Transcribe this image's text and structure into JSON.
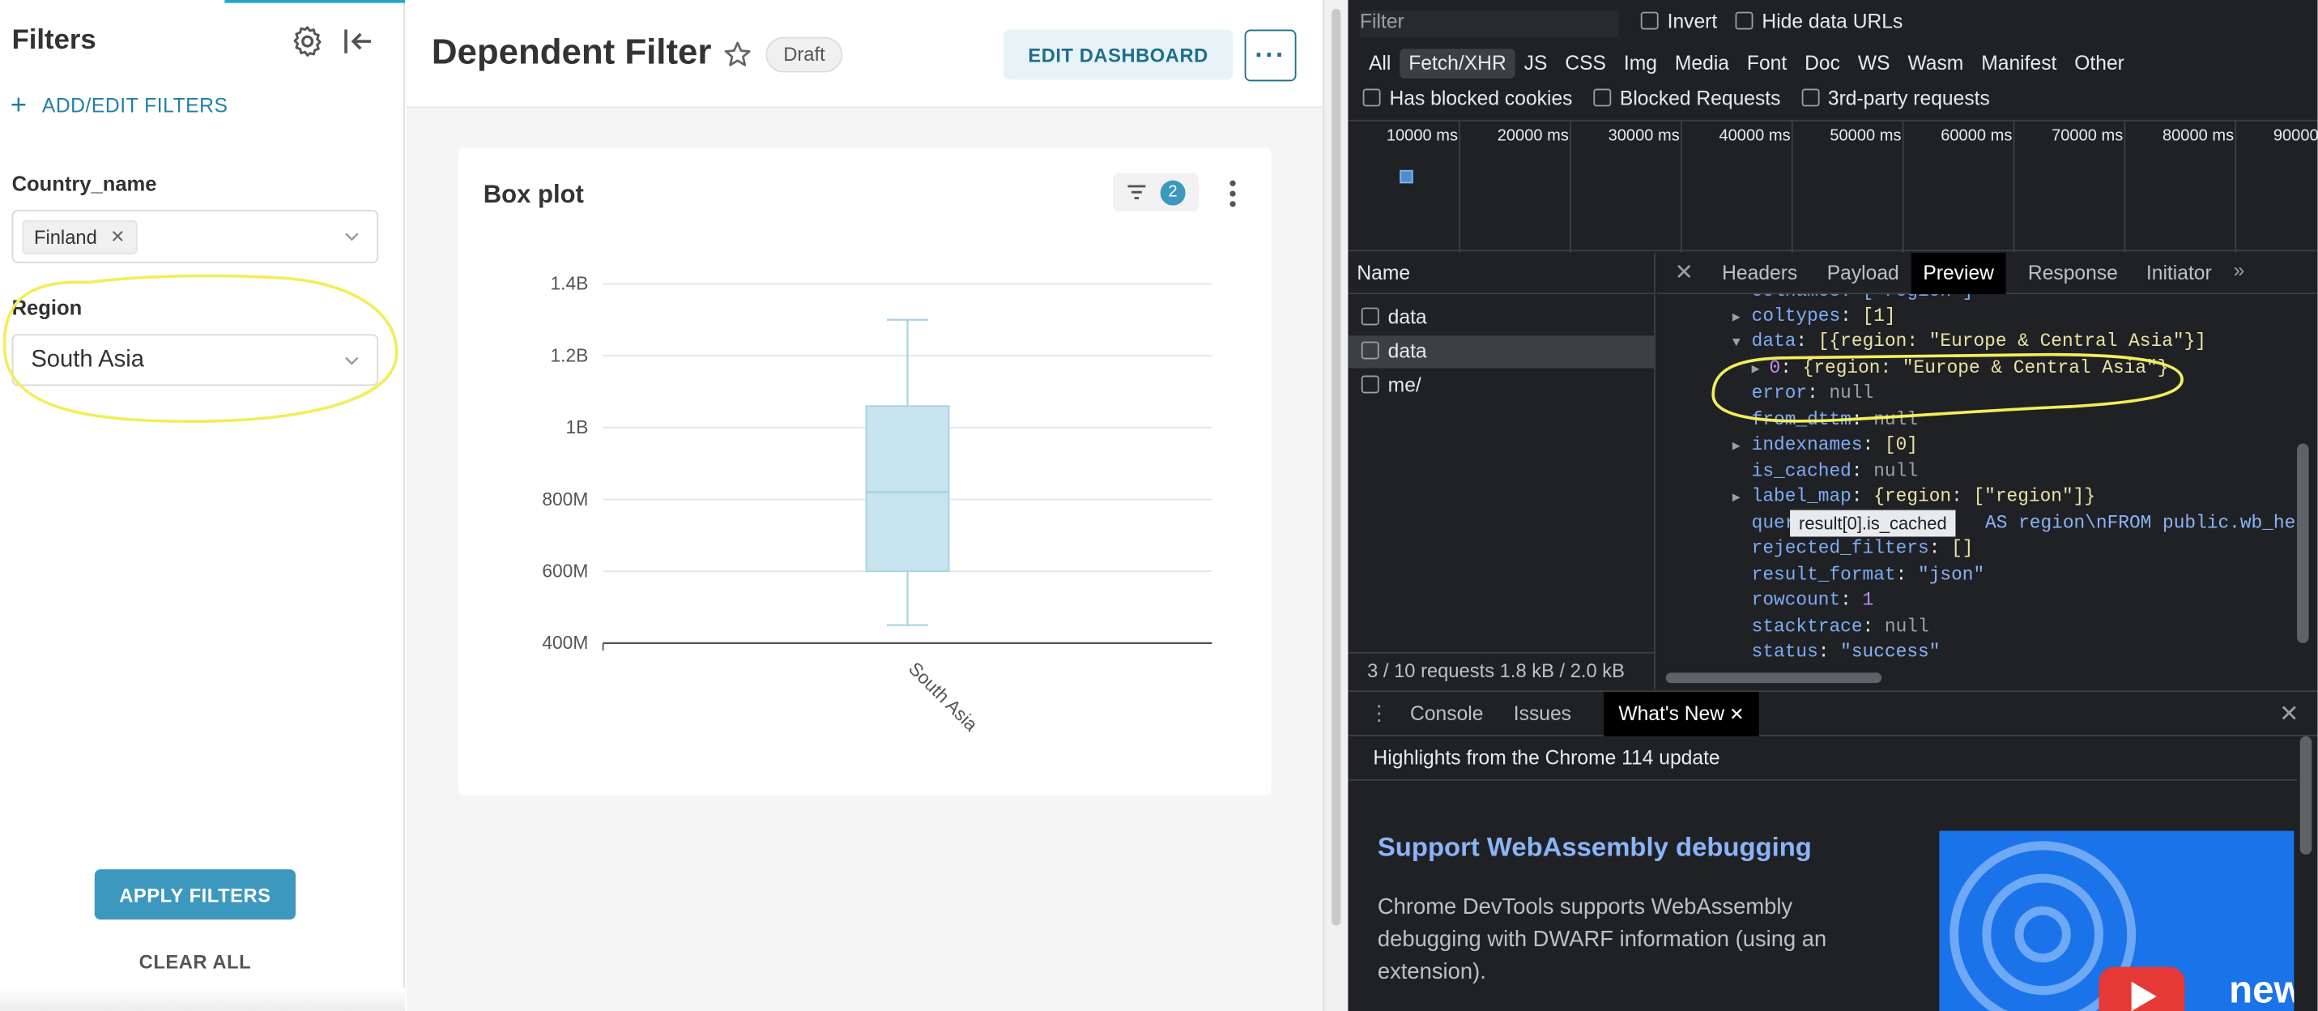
{
  "filters_panel": {
    "title": "Filters",
    "add_edit_label": "ADD/EDIT FILTERS",
    "country": {
      "label": "Country_name",
      "selected_tag": "Finland"
    },
    "region": {
      "label": "Region",
      "selected_value": "South Asia"
    },
    "apply_label": "APPLY FILTERS",
    "clear_label": "CLEAR ALL"
  },
  "dashboard": {
    "title": "Dependent Filter",
    "status_badge": "Draft",
    "edit_label": "EDIT DASHBOARD",
    "more_label": "···",
    "chart_card": {
      "title": "Box plot",
      "filter_count": "2"
    }
  },
  "chart_data": {
    "type": "box",
    "title": "Box plot",
    "categories": [
      "South Asia"
    ],
    "y_ticks": [
      "400M",
      "600M",
      "800M",
      "1B",
      "1.2B",
      "1.4B"
    ],
    "ylim": [
      400000000,
      1400000000
    ],
    "boxes": [
      {
        "category": "South Asia",
        "whisker_low": 450000000,
        "q1": 600000000,
        "median": 820000000,
        "q3": 1060000000,
        "whisker_high": 1300000000
      }
    ],
    "colors": {
      "box_fill": "#c6e3ee",
      "box_stroke": "#a9d3e3",
      "grid": "#dde8ee"
    }
  },
  "devtools": {
    "filter_placeholder": "Filter",
    "invert_label": "Invert",
    "hide_data_urls_label": "Hide data URLs",
    "type_filters": [
      "All",
      "Fetch/XHR",
      "JS",
      "CSS",
      "Img",
      "Media",
      "Font",
      "Doc",
      "WS",
      "Wasm",
      "Manifest",
      "Other"
    ],
    "active_type": "Fetch/XHR",
    "row3": [
      "Has blocked cookies",
      "Blocked Requests",
      "3rd-party requests"
    ],
    "timeline_labels": [
      "10000 ms",
      "20000 ms",
      "30000 ms",
      "40000 ms",
      "50000 ms",
      "60000 ms",
      "70000 ms",
      "80000 ms",
      "90000"
    ],
    "names_header": "Name",
    "requests": [
      "data",
      "data",
      "me/"
    ],
    "footer": "3 / 10 requests    1.8 kB / 2.0 kB",
    "detail_tabs": [
      "Headers",
      "Payload",
      "Preview",
      "Response",
      "Initiator"
    ],
    "active_detail_tab": "Preview",
    "json_lines": {
      "colnames_cut": "colnames: [\"region\"]",
      "coltypes_key": "coltypes",
      "coltypes_val": "[1]",
      "data_key": "data",
      "data_val": "[{region: \"Europe & Central Asia\"}]",
      "item0_key": "0",
      "item0_val": "{region: \"Europe & Central Asia\"}",
      "error_key": "error",
      "error_val": "null",
      "from_key": "from_dttm",
      "from_val": "null",
      "index_key": "indexnames",
      "index_val": "[0]",
      "cached_key": "is_cached",
      "cached_val": "null",
      "label_key": "label_map",
      "label_val": "{region: [\"region\"]}",
      "query_key": "quer",
      "query_val": "AS region\\nFROM public.wb_hea",
      "rejected_key": "rejected_filters",
      "rejected_val": "[]",
      "format_key": "result_format",
      "format_val": "\"json\"",
      "rowcount_key": "rowcount",
      "rowcount_val": "1",
      "stack_key": "stacktrace",
      "stack_val": "null",
      "status_key": "status",
      "status_val": "\"success\""
    },
    "tooltip": "result[0].is_cached",
    "drawer_tabs": [
      "Console",
      "Issues",
      "What's New"
    ],
    "active_drawer_tab": "What's New",
    "whats_new": {
      "heading": "Highlights from the Chrome 114 update",
      "title": "Support WebAssembly debugging",
      "description": "Chrome DevTools supports WebAssembly debugging with DWARF information (using an extension).",
      "image_text": "new"
    }
  }
}
